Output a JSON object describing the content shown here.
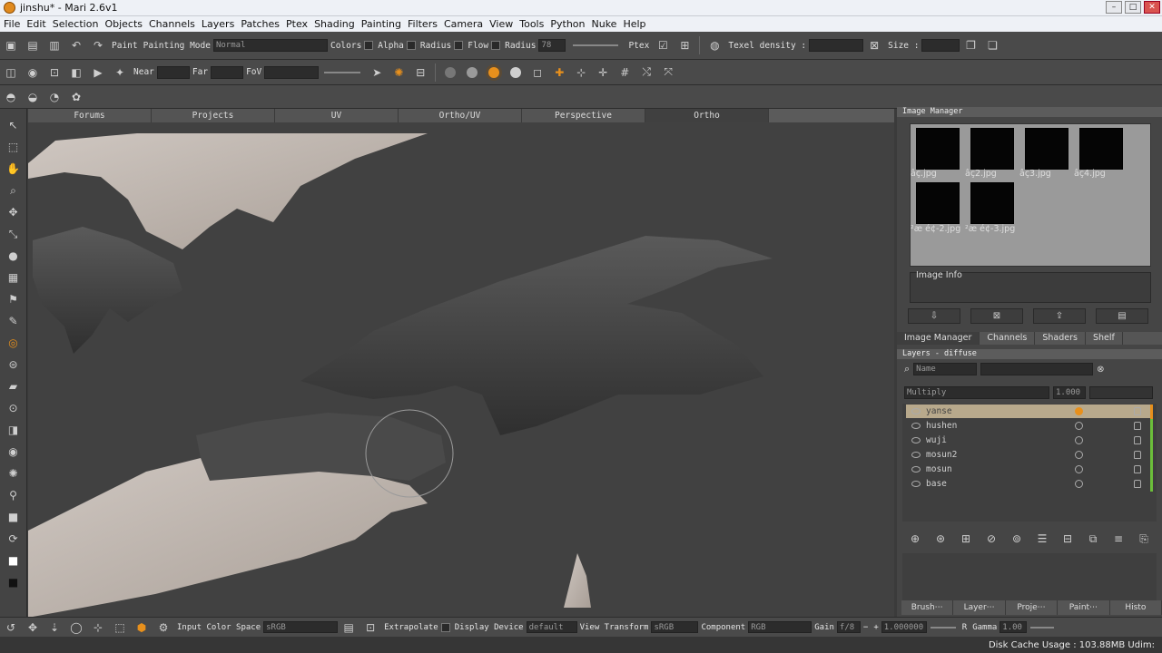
{
  "window": {
    "title": "jinshu* - Mari 2.6v1"
  },
  "menu": [
    "File",
    "Edit",
    "Selection",
    "Objects",
    "Channels",
    "Layers",
    "Patches",
    "Ptex",
    "Shading",
    "Painting",
    "Filters",
    "Camera",
    "View",
    "Tools",
    "Python",
    "Nuke",
    "Help"
  ],
  "toolbar1": {
    "paint_label": "Paint",
    "painting_mode_label": "Painting Mode",
    "painting_mode_value": "Normal",
    "colors_label": "Colors",
    "alpha_label": "Alpha",
    "radius_label": "Radius",
    "flow_label": "Flow",
    "radius2_label": "Radius",
    "radius_value": "78",
    "ptex_label": "Ptex",
    "texel_density_label": "Texel density :",
    "size_label": "Size :"
  },
  "toolbar2": {
    "near_label": "Near",
    "far_label": "Far",
    "fov_label": "FoV"
  },
  "viewport_tabs": [
    "Forums",
    "Projects",
    "UV",
    "Ortho/UV",
    "Perspective",
    "Ortho"
  ],
  "image_manager": {
    "title": "Image Manager",
    "images": [
      "âç.jpg",
      "âç2.jpg",
      "âç3.jpg",
      "âç4.jpg",
      "²æ é¢-2.jpg",
      "²æ é¢-3.jpg"
    ],
    "info_label": "Image Info"
  },
  "panel_tabs": [
    "Image Manager",
    "Channels",
    "Shaders",
    "Shelf"
  ],
  "layers": {
    "title": "Layers - diffuse",
    "filter_label": "Name",
    "blend_mode": "Multiply",
    "opacity": "1.000",
    "items": [
      "yanse",
      "hushen",
      "wuji",
      "mosun2",
      "mosun",
      "base"
    ]
  },
  "bottom_tabs": [
    "Brush⋯",
    "Layer⋯",
    "Proje⋯",
    "Paint⋯",
    "Histo"
  ],
  "bottombar": {
    "input_color_space_label": "Input Color Space",
    "input_color_space_value": "sRGB",
    "extrapolate_label": "Extrapolate",
    "display_device_label": "Display Device",
    "display_device_value": "default",
    "view_transform_label": "View Transform",
    "view_transform_value": "sRGB",
    "component_label": "Component",
    "component_value": "RGB",
    "gain_label": "Gain",
    "gain_mode": "f/8",
    "gain_value": "1.000000",
    "gamma_channel": "R",
    "gamma_label": "Gamma",
    "gamma_value": "1.00"
  },
  "status": {
    "disk_cache": "Disk Cache Usage : 103.88MB Udim:"
  },
  "colors": {
    "accent": "#e8901c",
    "layer_highlight": "#b8a98c"
  }
}
